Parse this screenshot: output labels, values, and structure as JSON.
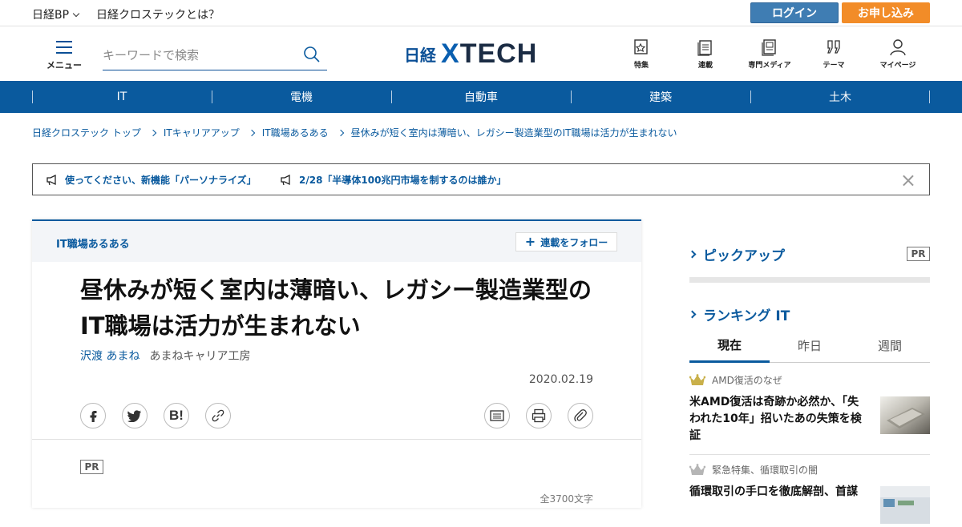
{
  "utility": {
    "nikkei_bp": "日経BP",
    "about": "日経クロステックとは？",
    "login": "ログイン",
    "apply": "お申し込み"
  },
  "header": {
    "menu_label": "メニュー",
    "search_placeholder": "キーワードで検索",
    "logo_prefix": "日経",
    "logo_x": "X",
    "logo_tech": "TECH",
    "nav": [
      {
        "label": "特集",
        "icon": "feature-icon"
      },
      {
        "label": "連載",
        "icon": "series-icon"
      },
      {
        "label": "専門メディア",
        "icon": "media-icon"
      },
      {
        "label": "テーマ",
        "icon": "theme-icon"
      },
      {
        "label": "マイページ",
        "icon": "user-icon"
      }
    ]
  },
  "categories": [
    "IT",
    "電機",
    "自動車",
    "建築",
    "土木"
  ],
  "breadcrumb": [
    "日経クロステック トップ",
    "ITキャリアアップ",
    "IT職場あるある",
    "昼休みが短く室内は薄暗い、レガシー製造業型のIT職場は活力が生まれない"
  ],
  "notices": [
    "使ってください、新機能「パーソナライズ」",
    "2/28「半導体100兆円市場を制するのは誰か」"
  ],
  "article": {
    "series": "IT職場あるある",
    "follow": "連載をフォロー",
    "title": "昼休みが短く室内は薄暗い、レガシー製造業型のIT職場は活力が生まれない",
    "author": "沢渡 あまね",
    "org": "あまねキャリア工房",
    "date": "2020.02.19",
    "pr": "PR",
    "word_count": "全3700文字"
  },
  "sidebar": {
    "pickup": "ピックアップ",
    "pr": "PR",
    "ranking": "ランキング IT",
    "tabs": [
      "現在",
      "昨日",
      "週間"
    ],
    "active_tab": 0,
    "items": [
      {
        "kicker": "AMD復活のなぜ",
        "headline": "米AMD復活は奇跡か必然か、「失われた10年」招いたあの失策を検証"
      },
      {
        "kicker": "緊急特集、循環取引の闇",
        "headline": "循環取引の手口を徹底解剖、首謀"
      }
    ]
  },
  "colors": {
    "brand": "#0a5a9e",
    "login": "#3f7db3",
    "apply": "#f28c28",
    "crown_gold": "#c9b04a",
    "crown_silver": "#b5b5b5"
  }
}
